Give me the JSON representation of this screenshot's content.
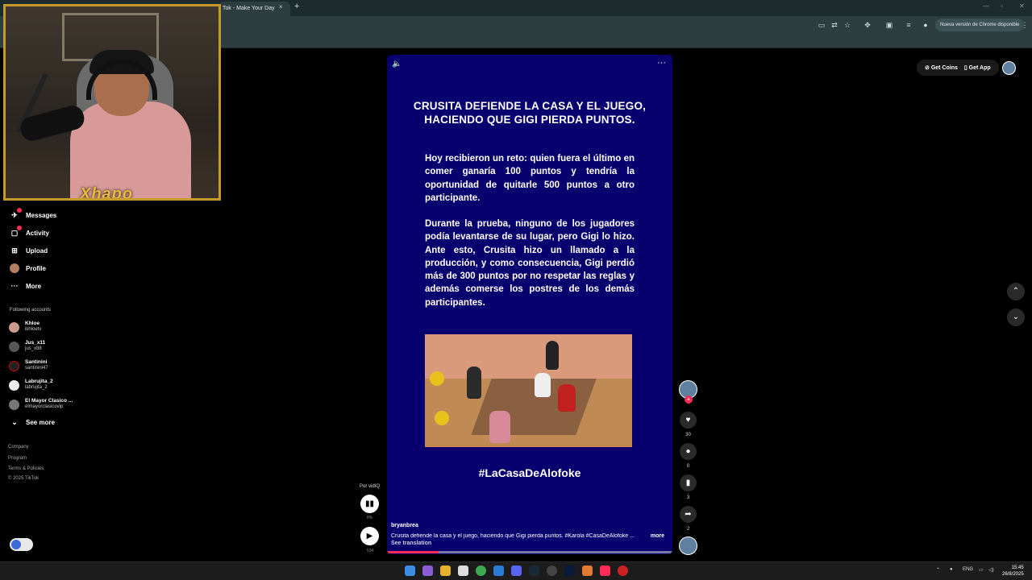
{
  "browser": {
    "tab_title": "Tok - Make Your Day",
    "tab_close": "×",
    "new_tab": "+",
    "update_label": "Nueva versión de Chrome disponible"
  },
  "webcam": {
    "logo_text": "Xhapo"
  },
  "header": {
    "get_coins": "Get Coins",
    "get_app": "Get App"
  },
  "sidebar": {
    "items": [
      {
        "label": "Messages",
        "icon": "messages-icon"
      },
      {
        "label": "Activity",
        "icon": "activity-icon"
      },
      {
        "label": "Upload",
        "icon": "upload-icon"
      },
      {
        "label": "Profile",
        "icon": "profile-avatar"
      },
      {
        "label": "More",
        "icon": "more-icon"
      }
    ],
    "following_header": "Following accounts",
    "accounts": [
      {
        "name": "Khloe",
        "handle": "ikhloetv"
      },
      {
        "name": "Jus_x11",
        "handle": "jus_x88"
      },
      {
        "name": "Santinini",
        "handle": "santinini47"
      },
      {
        "name": "Labrujita_2",
        "handle": "labrujita_2"
      },
      {
        "name": "El Mayor Clasico ...",
        "handle": "elmayorclasicovip"
      }
    ],
    "see_more": "See more",
    "footer": [
      "Company",
      "Program",
      "Terms & Policies",
      "© 2025 TikTok"
    ]
  },
  "video": {
    "title": "CRUSITA DEFIENDE LA CASA Y EL JUEGO, HACIENDO QUE GIGI PIERDA PUNTOS.",
    "para1": "Hoy recibieron un reto: quien fuera el último en comer ganaría 100 puntos y tendría la oportunidad de quitarle 500 puntos a otro participante.",
    "para2": "Durante la prueba, ninguno de los jugadores podía levantarse de su lugar, pero Gigi lo hizo. Ante esto, Crusita hizo un llamado a la producción, y como consecuencia, Gigi perdió más de 300 puntos por no respetar las reglas y además comerse los postres de los demás participantes.",
    "hashtag": "#LaCasaDeAlofoke",
    "username": "bryanbrea",
    "caption": "Crusita defiende la casa y el juego, haciendo que Gigi pierda puntos. #Karola  #CasaDeAlofoke  ...",
    "caption_more": "more",
    "see_translation": "See translation",
    "progress": 0.18
  },
  "actions": {
    "likes": "30",
    "comments": "0",
    "saves": "3",
    "shares": "2"
  },
  "player_widget": {
    "label": "Por vidIQ",
    "percent": "8%",
    "count": "534"
  },
  "taskbar": {
    "lang": "ENG",
    "time": "15:45",
    "date": "26/8/2025"
  },
  "colors": {
    "video_bg": "#090070",
    "accent": "#fe2c55",
    "webcam_border": "#c59a2a"
  }
}
